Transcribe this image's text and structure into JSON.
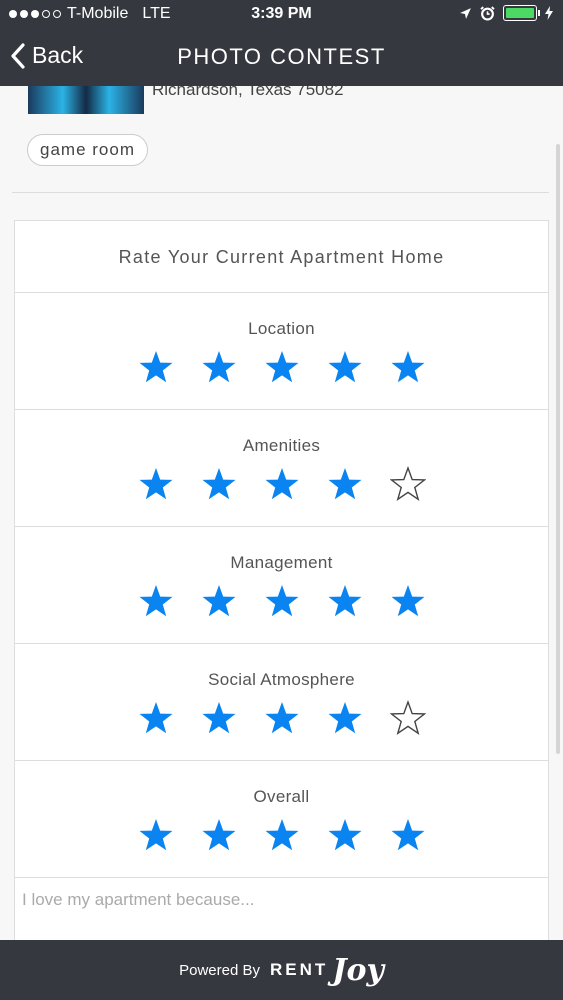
{
  "status_bar": {
    "carrier": "T-Mobile",
    "network": "LTE",
    "time": "3:39 PM",
    "signal_dots_filled": 3,
    "signal_dots_total": 5,
    "battery_level": 1.0,
    "icons": [
      "location-arrow-icon",
      "alarm-icon",
      "battery-icon",
      "charging-icon"
    ]
  },
  "nav": {
    "back_label": "Back",
    "title": "PHOTO CONTEST"
  },
  "listing": {
    "address": "Richardson, Texas 75082",
    "tag": "game room"
  },
  "rating_card": {
    "title": "Rate Your Current Apartment Home",
    "max_stars": 5,
    "items": [
      {
        "label": "Location",
        "rating": 5
      },
      {
        "label": "Amenities",
        "rating": 4
      },
      {
        "label": "Management",
        "rating": 5
      },
      {
        "label": "Social Atmosphere",
        "rating": 4
      },
      {
        "label": "Overall",
        "rating": 5
      }
    ]
  },
  "comment": {
    "placeholder": "I love my apartment because..."
  },
  "footer": {
    "powered_by": "Powered By",
    "brand_rent": "RENT",
    "brand_joy": "Joy"
  },
  "colors": {
    "bar_background": "#35383e",
    "star_active": "#0a84f0",
    "star_outline": "#444444",
    "battery": "#4cd964"
  }
}
